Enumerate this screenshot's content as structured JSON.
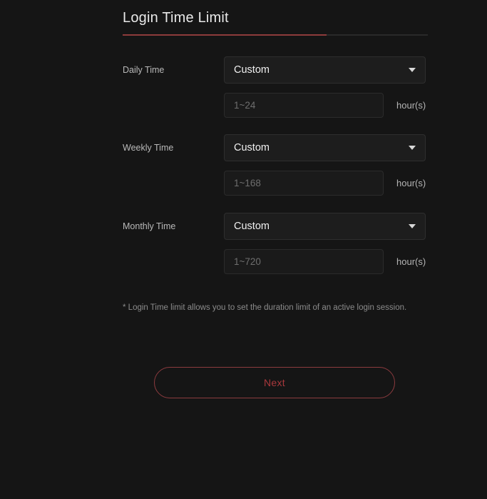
{
  "page": {
    "title": "Login Time Limit",
    "background_color": "#151515",
    "accent_color": "#8e3b3b"
  },
  "form": {
    "rows": [
      {
        "label": "Daily Time",
        "select_value": "Custom",
        "select_icon": "chevron-down-icon",
        "input_placeholder": "1~24",
        "input_value": "",
        "unit": "hour(s)"
      },
      {
        "label": "Weekly Time",
        "select_value": "Custom",
        "select_icon": "chevron-down-icon",
        "input_placeholder": "1~168",
        "input_value": "",
        "unit": "hour(s)"
      },
      {
        "label": "Monthly Time",
        "select_value": "Custom",
        "select_icon": "chevron-down-icon",
        "input_placeholder": "1~720",
        "input_value": "",
        "unit": "hour(s)"
      }
    ]
  },
  "note": {
    "text": "* Login Time limit allows you to set the duration limit of an active login session."
  },
  "actions": {
    "next_label": "Next",
    "next_color": "#a8383c"
  }
}
